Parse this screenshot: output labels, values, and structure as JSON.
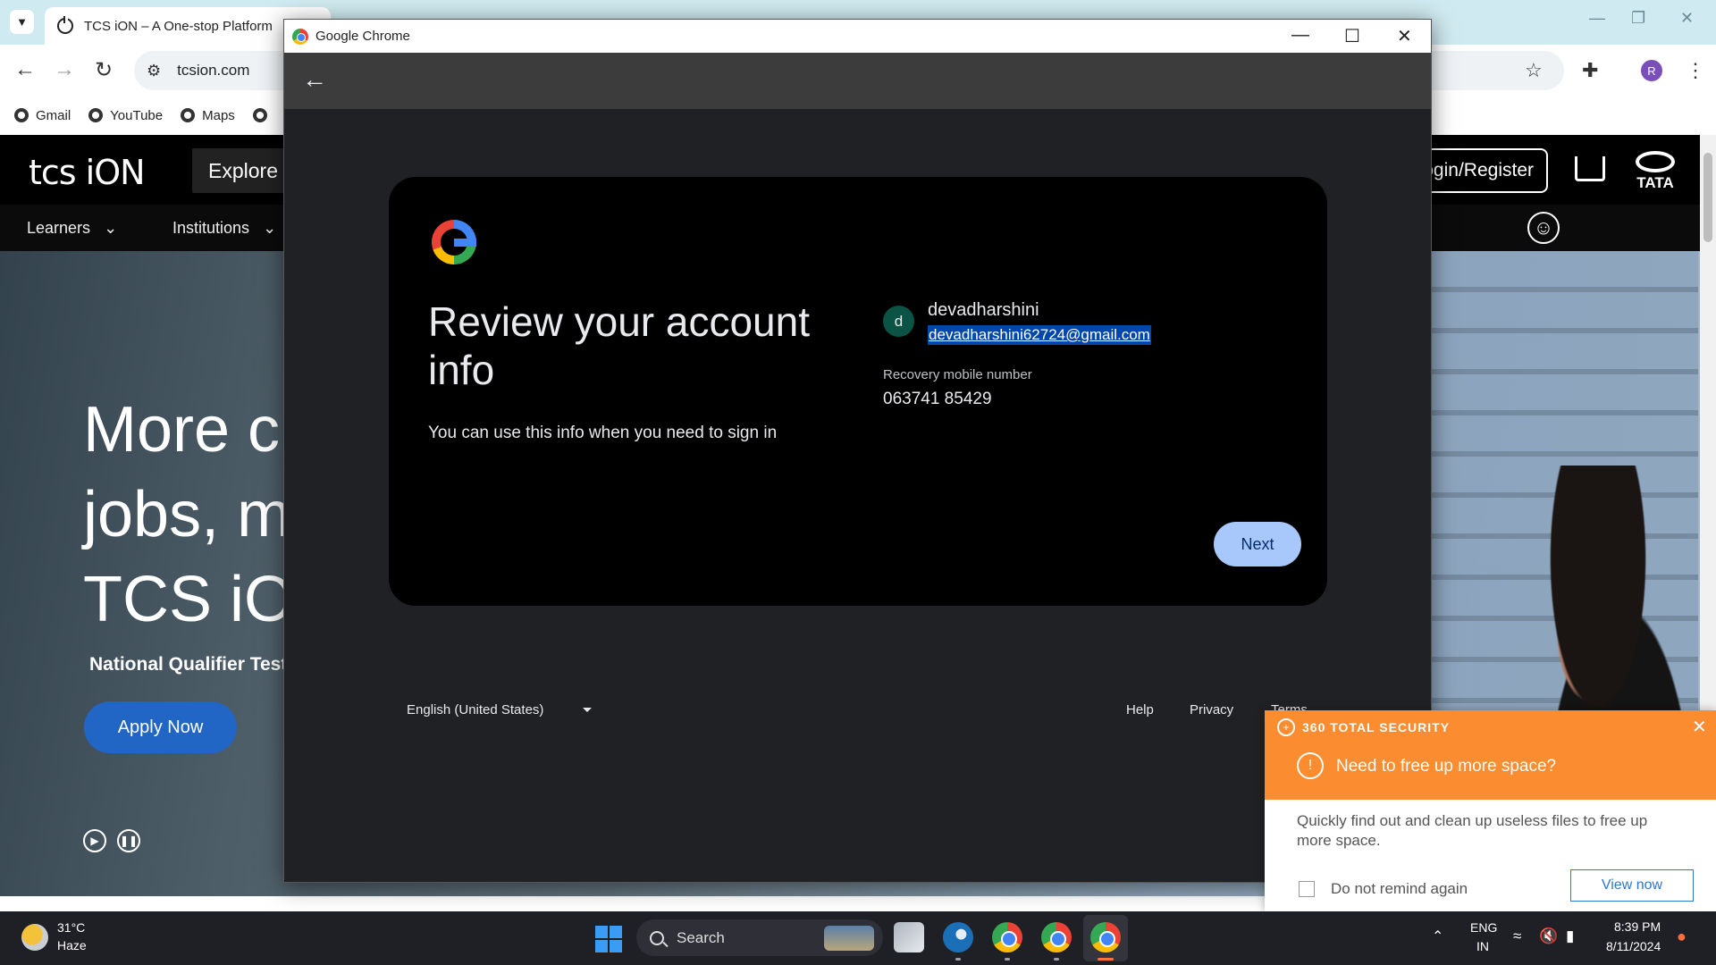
{
  "background_browser": {
    "tab": {
      "title": "TCS iON – A One-stop Platform",
      "close_icon": "close-icon"
    },
    "address": "tcsion.com",
    "bookmarks": [
      {
        "label": "Gmail",
        "icon": "globe-icon"
      },
      {
        "label": "YouTube",
        "icon": "globe-icon"
      },
      {
        "label": "Maps",
        "icon": "globe-icon"
      }
    ],
    "profile_initial": "R"
  },
  "site": {
    "logo": "tcs iON",
    "explore_label": "Explore",
    "login_label": "Login/Register",
    "tata_label": "TATA",
    "nav": [
      {
        "label": "Learners"
      },
      {
        "label": "Institutions"
      }
    ],
    "hero": {
      "line1": "More c",
      "line2": "jobs, m",
      "line3": "TCS iO",
      "subtitle": "National Qualifier Test",
      "apply_label": "Apply Now"
    }
  },
  "popup": {
    "window_title": "Google Chrome",
    "card": {
      "title": "Review your account info",
      "subtitle": "You can use this info when you need to sign in",
      "account_initial": "d",
      "account_name": "devadharshini",
      "account_email": "devadharshini62724@gmail.com",
      "recovery_label": "Recovery mobile number",
      "recovery_value": "063741 85429",
      "next_label": "Next"
    },
    "footer": {
      "language": "English (United States)",
      "help": "Help",
      "privacy": "Privacy",
      "terms": "Terms"
    }
  },
  "notification": {
    "brand": "360 TOTAL SECURITY",
    "title": "Need to free up more space?",
    "body": "Quickly find out and clean up useless files to free up more space.",
    "checkbox_label": "Do not remind again",
    "action_label": "View now"
  },
  "taskbar": {
    "weather_temp": "31°C",
    "weather_desc": "Haze",
    "search_label": "Search",
    "lang_top": "ENG",
    "lang_bottom": "IN",
    "time": "8:39 PM",
    "date": "8/11/2024"
  },
  "colors": {
    "accent_blue": "#a8c7fa",
    "notification_orange": "#fb8c2f",
    "apply_blue": "#2166c5"
  }
}
